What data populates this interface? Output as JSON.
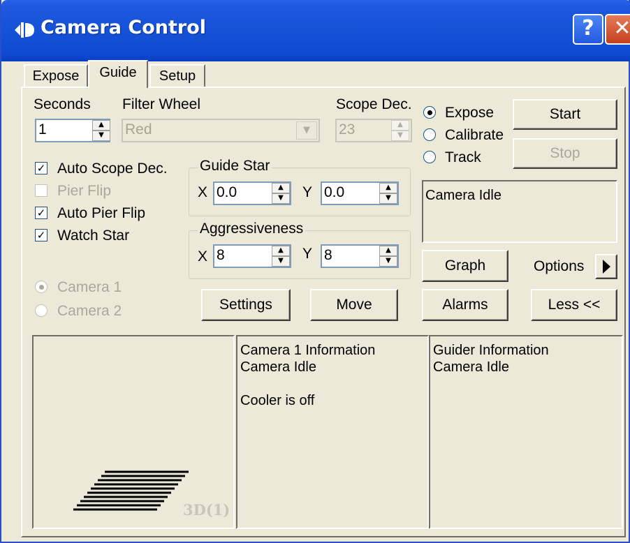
{
  "window": {
    "title": "Camera Control",
    "help_label": "?",
    "close_label": "✕"
  },
  "tabs": [
    {
      "label": "Expose"
    },
    {
      "label": "Guide"
    },
    {
      "label": "Setup"
    }
  ],
  "fields": {
    "seconds_label": "Seconds",
    "seconds_value": "1",
    "filter_wheel_label": "Filter Wheel",
    "filter_wheel_value": "Red",
    "scope_dec_label": "Scope Dec.",
    "scope_dec_value": "23"
  },
  "modes": [
    {
      "label": "Expose",
      "selected": true
    },
    {
      "label": "Calibrate",
      "selected": false
    },
    {
      "label": "Track",
      "selected": false
    }
  ],
  "buttons": {
    "start": "Start",
    "stop": "Stop",
    "graph": "Graph",
    "options": "Options",
    "settings": "Settings",
    "move": "Move",
    "alarms": "Alarms",
    "less": "Less <<"
  },
  "status_text": "Camera Idle",
  "checkboxes": [
    {
      "label": "Auto Scope Dec.",
      "checked": true,
      "enabled": true
    },
    {
      "label": "Pier Flip",
      "checked": false,
      "enabled": false
    },
    {
      "label": "Auto Pier Flip",
      "checked": true,
      "enabled": true
    },
    {
      "label": "Watch Star",
      "checked": true,
      "enabled": true
    }
  ],
  "guide_star": {
    "title": "Guide Star",
    "x_label": "X",
    "x_value": "0.0",
    "y_label": "Y",
    "y_value": "0.0"
  },
  "aggressiveness": {
    "title": "Aggressiveness",
    "x_label": "X",
    "x_value": "8",
    "y_label": "Y",
    "y_value": "8"
  },
  "cameras": [
    {
      "label": "Camera 1",
      "selected": true
    },
    {
      "label": "Camera 2",
      "selected": false
    }
  ],
  "preview": {
    "badge": "3D(1)"
  },
  "camera_info": {
    "title": "Camera 1 Information",
    "status": "Camera Idle",
    "cooler": "Cooler is off"
  },
  "guider_info": {
    "title": "Guider Information",
    "status": "Camera Idle"
  },
  "colors": {
    "title_bar": "#0f4cd2",
    "window_bg": "#ece9d8"
  },
  "icons": {
    "app": "telescope-icon",
    "options": "triangle-right-icon"
  }
}
